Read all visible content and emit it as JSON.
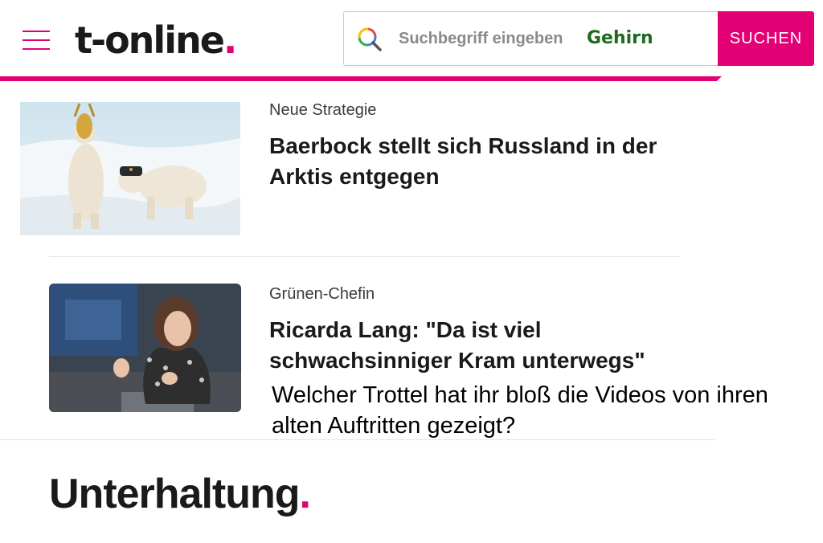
{
  "header": {
    "logo_text": "t-online",
    "logo_dot": ".",
    "search": {
      "placeholder": "Suchbegriff eingeben",
      "value": "Gehirn",
      "button_label": "SUCHEN"
    }
  },
  "articles": [
    {
      "kicker": "Neue Strategie",
      "headline": "Baerbock stellt sich Russland in der Arktis entgegen"
    },
    {
      "kicker": "Grünen-Chefin",
      "headline": "Ricarda Lang: \"Da ist viel schwachsinniger Kram unterwegs\""
    }
  ],
  "caption": "Welcher Trottel hat ihr bloß die Videos von ihren alten Auftritten gezeigt?",
  "section": {
    "title": "Unterhaltung",
    "dot": "."
  },
  "colors": {
    "brand": "#e20074",
    "search_value": "#1e6b1e"
  }
}
